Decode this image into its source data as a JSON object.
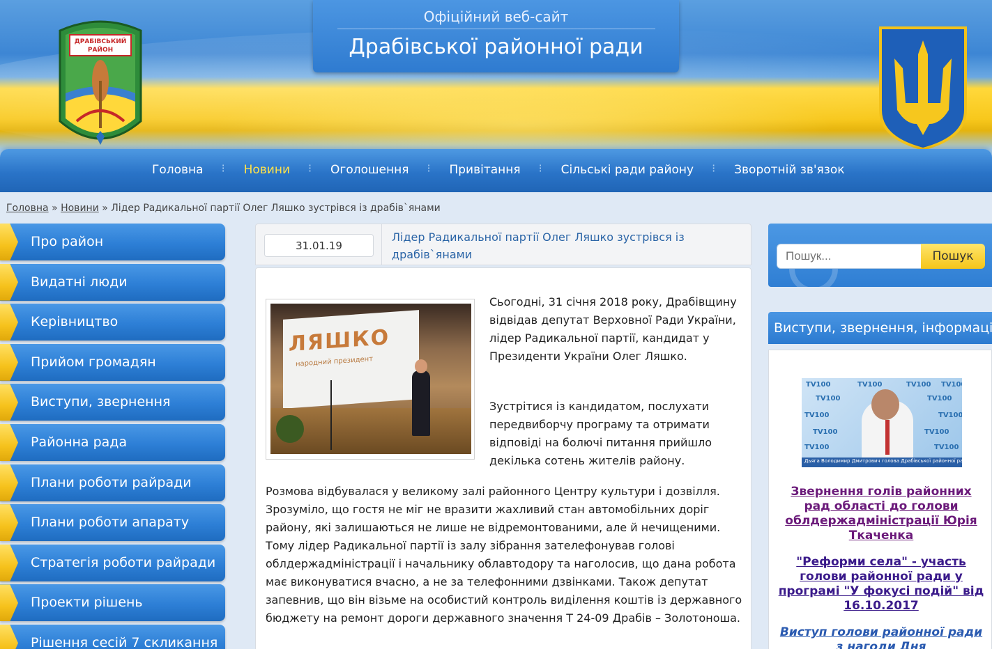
{
  "header": {
    "subtitle": "Офіційний веб-сайт",
    "title": "Драбівської районної ради",
    "emblem_text": "Драбівський район"
  },
  "nav": {
    "items": [
      {
        "label": "Головна",
        "active": false
      },
      {
        "label": "Новини",
        "active": true
      },
      {
        "label": "Оголошення",
        "active": false
      },
      {
        "label": "Привітання",
        "active": false
      },
      {
        "label": "Сільські ради району",
        "active": false
      },
      {
        "label": "Зворотній зв'язок",
        "active": false
      }
    ]
  },
  "breadcrumb": {
    "home": "Головна",
    "section": "Новини",
    "separator": "»",
    "current": "Лідер Радикальної партії Олег Ляшко зустрівся із драбів`янами"
  },
  "side_menu": {
    "items": [
      "Про район",
      "Видатні люди",
      "Керівництво",
      "Прийом громадян",
      "Виступи, звернення",
      "Районна рада",
      "Плани роботи райради",
      "Плани роботи апарату",
      "Стратегія роботи райради",
      "Проекти рішень",
      "Рішення сесій 7 скликання"
    ]
  },
  "article": {
    "date": "31.01.19",
    "title": "Лідер Радикальної партії Олег Ляшко зустрівся із драбів`янами",
    "photo_text": "ЛЯШКО",
    "photo_subtext": "народний президент",
    "paragraphs": [
      "Сьогодні, 31 січня 2018 року, Драбівщину відвідав депутат Верховної Ради України, лідер Радикальної партії, кандидат у Президенти України Олег Ляшко.",
      "Зустрітися із кандидатом, послухати передвиборчу програму та отримати відповіді на болючі питання прийшло декілька сотень жителів району.",
      "Розмова відбувалася у великому залі районного Центру культури і дозвілля. Зрозуміло, що гостя не міг не вразити жахливий стан автомобільних доріг району, які залишаються не лише не відремонтованими, але й нечищеними. Тому лідер Радикальної партії із залу зібрання зателефонував голові облдержадміністрації і начальнику облавтодору та наголосив, що дана робота має виконуватися вчасно, а не за телефонними дзвінками. Також депутат запевнив, що він візьме на особистий контроль виділення коштів із державного бюджету на ремонт дороги державного значення Т 24-09 Драбів – Золотоноша."
    ]
  },
  "search": {
    "placeholder": "Пошук...",
    "button": "Пошук"
  },
  "sidebar": {
    "heading": "Виступи, звернення, інформації",
    "video_caption": "Дьяга Володимир Дмитрович голова Драбівської районної ради",
    "video_logo": "TV100",
    "links": [
      "Звернення голів районних рад області до голови облдержадміністрації Юрія Ткаченка",
      "\"Реформи села\" - участь голови районної ради у програмі \"У фокусі подій\" від 16.10.2017",
      "Виступ голови районної ради з нагоди Дня"
    ]
  },
  "colors": {
    "nav_blue": "#2a74c8",
    "accent_yellow": "#ffe24a",
    "link_title": "#2a64a6"
  }
}
